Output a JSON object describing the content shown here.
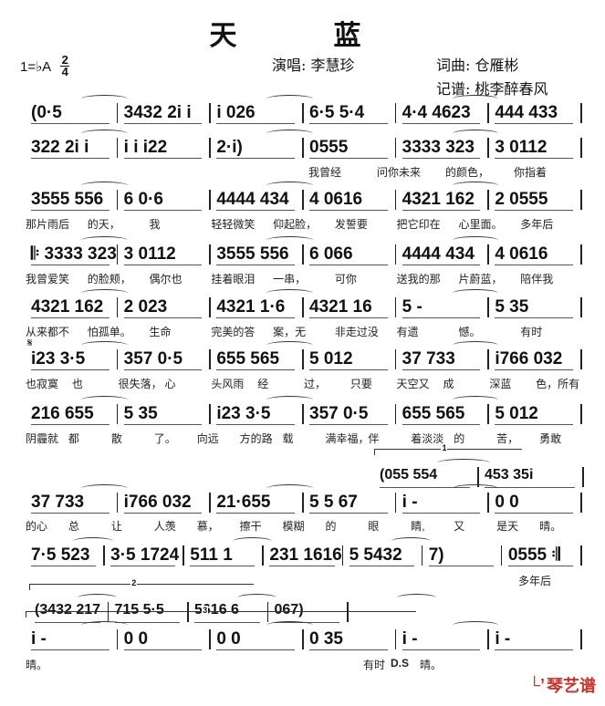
{
  "title": "天　蓝",
  "key": {
    "label": "1=♭A",
    "time_top": "2",
    "time_bottom": "4"
  },
  "credits": {
    "singer": "演唱: 李慧珍",
    "lyrics_music": "词曲: 仓雁彬",
    "transcriber": "记谱: 桃李醉春风"
  },
  "segno": "𝄋",
  "rows": [
    {
      "measures": [
        "(0·5",
        "3432 2i i",
        "i 026",
        "6·5 5·4",
        "4·4 4623",
        "444 433"
      ],
      "lyrics": []
    },
    {
      "measures": [
        "322 2i i",
        "i i i22",
        "2·i)",
        "0555",
        "3333 323",
        "3 0112"
      ],
      "lyrics": [
        "我曾经",
        "问你未来",
        "的颜色，",
        "你指着"
      ]
    },
    {
      "measures": [
        "3555 556",
        "6 0·6",
        "4444 434",
        "4 0616",
        "4321 162",
        "2 0555"
      ],
      "lyrics": [
        "那片雨后",
        "的天，",
        "我",
        "轻轻微笑",
        "仰起脸，",
        "发誓要",
        "把它印在",
        "心里面。",
        "多年后"
      ]
    },
    {
      "measures": [
        "𝄆 3333 323",
        "3 0112",
        "3555 556",
        "6 066",
        "4444 434",
        "4 0616"
      ],
      "lyrics": [
        "我曾爱笑",
        "的脸颊，",
        "偶尔也",
        "挂着眼泪",
        "一串，",
        "可你",
        "送我的那",
        "片蔚蓝，",
        "陪伴我"
      ]
    },
    {
      "measures": [
        "4321 162",
        "2 023",
        "4321 1·6",
        "4321 16",
        "5 -",
        "5 35"
      ],
      "lyrics": [
        "从来都不",
        "怕孤单。",
        "生命",
        "完美的答",
        "案，无",
        "非走过没",
        "有遗",
        "憾。",
        "有时"
      ]
    },
    {
      "measures": [
        "i23 3·5",
        "357 0·5",
        "655 565",
        "5 012",
        "37 733",
        "i766 032"
      ],
      "lyrics": [
        "也寂寞",
        "也",
        "很失落，",
        "心",
        "头风雨",
        "经",
        "过，",
        "只要",
        "天空又",
        "成",
        "深蓝",
        "色，所有"
      ]
    },
    {
      "measures": [
        "216 655",
        "5 35",
        "i23 3·5",
        "357 0·5",
        "655 565",
        "5 012"
      ],
      "lyrics": [
        "阴霾就",
        "都",
        "散",
        "了。",
        "向远",
        "方的路",
        "载",
        "满幸福，",
        "伴",
        "着淡淡",
        "的",
        "苦，",
        "勇敢"
      ]
    },
    {
      "measures": [
        "(055 554",
        "453 35i"
      ],
      "lyrics": [],
      "bracket": "1"
    },
    {
      "measures": [
        "37 733",
        "i766 032",
        "21·655",
        "5 5 67",
        "i -",
        "0 0"
      ],
      "lyrics": [
        "的心",
        "总",
        "让",
        "人羡",
        "慕，",
        "擦干",
        "模糊",
        "的",
        "眼",
        "睛,",
        "又",
        "是天",
        "晴。"
      ]
    },
    {
      "measures": [
        "7·5 523",
        "3·5 1724",
        "511 1",
        "231 1616",
        "5 5432",
        "7)",
        "0555 𝄇"
      ],
      "lyrics": [
        "多年后"
      ]
    },
    {
      "measures": [
        "(3432 217",
        "715 5·5",
        "5616 6",
        "067)"
      ],
      "lyrics": [],
      "bracket": "2"
    },
    {
      "measures": [
        "i -",
        "0 0",
        "0 0",
        "0 35",
        "i -",
        "i -"
      ],
      "lyrics": [
        "晴。",
        "有时",
        "D.S",
        "晴。"
      ],
      "bracket": "3"
    }
  ],
  "watermark": {
    "text": "琴艺谱",
    "color": "#c8332b"
  }
}
